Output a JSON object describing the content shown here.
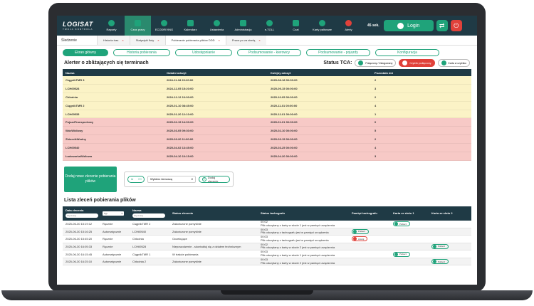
{
  "app": {
    "logo": "LOGISAT",
    "logo_sub": "TWOJA KONTROLA"
  },
  "nav": [
    {
      "label": "Raporty",
      "icon": "report-icon"
    },
    {
      "label": "Czas pracy",
      "icon": "clock-icon"
    },
    {
      "label": "ECODRIVING",
      "icon": "eco-drop-icon"
    },
    {
      "label": "Kalendarz",
      "icon": "calendar-icon"
    },
    {
      "label": "Ustawienia",
      "icon": "gear-icon"
    },
    {
      "label": "Administracja",
      "icon": "admin-icon"
    },
    {
      "label": "e-TOLL",
      "icon": "etoll-icon"
    },
    {
      "label": "Czat",
      "icon": "chat-icon"
    },
    {
      "label": "Karty paliwowe",
      "icon": "fuel-card-icon"
    },
    {
      "label": "Alerty",
      "icon": "alert-bell-icon"
    }
  ],
  "timer": "45 sek.",
  "login_label": "Login",
  "crumbs": {
    "home": "Śledzenie",
    "tabs": [
      "Historia tras",
      "Statystyki floty",
      "Pobieranie pobierania plików DDD",
      "Praca po za strefą"
    ]
  },
  "subtabs": [
    "Ekran główny",
    "Historia pobierania",
    "Udostępnianie",
    "Podsumowanie - kierowcy",
    "Podsumowanie - pojazdy",
    "Konfiguracja"
  ],
  "alerter": {
    "title": "Alerter o zbliżających się terminach",
    "tca_label": "Status TCA:",
    "tca_pills": [
      "Połączony / Zalogowany",
      "Czytnik podłączony",
      "Karta w czytniku"
    ]
  },
  "alerts_table": {
    "headers": [
      "Nazwa",
      "Ostatni odczyt",
      "Kolejny odczyt",
      "Pozostało dni"
    ],
    "rows": [
      {
        "name": "CiągnikTMR 3",
        "last": "2024-11-18 20:20:00",
        "next": "2025-08-18 00:00:00",
        "days": "2",
        "color": "yellow"
      },
      {
        "name": "LCH69528",
        "last": "2024-12-05 15:20:00",
        "next": "2025-09-15 00:00:00",
        "days": "3",
        "color": "yellow"
      },
      {
        "name": "Chłodnia",
        "last": "2024-12-12 10:00:00",
        "next": "2025-10-05 00:00:00",
        "days": "2",
        "color": "yellow"
      },
      {
        "name": "CiągnikTMR 2",
        "last": "2025-01-10 08:45:00",
        "next": "2025-11-01 00:00:00",
        "days": "4",
        "color": "yellow"
      },
      {
        "name": "LCH69535",
        "last": "2025-01-20 12:10:00",
        "next": "2025-12-01 00:00:00",
        "days": "1",
        "color": "yellow"
      },
      {
        "name": "PojazdTransportowy",
        "last": "2025-02-15 14:00:00",
        "next": "2025-01-01 00:00:00",
        "days": "0",
        "color": "red"
      },
      {
        "name": "WózWidlowy",
        "last": "2025-03-05 09:30:00",
        "next": "2025-02-10 00:00:00",
        "days": "5",
        "color": "red"
      },
      {
        "name": "ZbiornikWodny",
        "last": "2025-03-20 11:00:00",
        "next": "2025-03-15 00:00:00",
        "days": "2",
        "color": "red"
      },
      {
        "name": "LCH69540",
        "last": "2025-04-02 13:45:00",
        "next": "2025-03-25 00:00:00",
        "days": "4",
        "color": "red"
      },
      {
        "name": "ŁadowarkaWidlowa",
        "last": "2025-04-10 10:15:00",
        "next": "2025-04-20 00:00:00",
        "days": "3",
        "color": "red"
      }
    ]
  },
  "orders_panel": {
    "add_order": "Dodaj nowe zlecenie pobierania plików",
    "driver_select": "Wybierz kierowcę",
    "add_button": "Dodaj zlecenie"
  },
  "orders": {
    "title": "Lista zleceń pobierania plików",
    "headers": [
      "Data zlecenia",
      "Typ",
      "Nazwa",
      "Status zlecenia",
      "Status tachografu",
      "Pamięć tachografu",
      "Karta ze slotu 1",
      "Karta ze slotu 2"
    ],
    "filter_placeholder": "Wyszukaj",
    "type_filter": "Typ",
    "rows": [
      {
        "date": "2025-06-30 15:19:12",
        "type": "Ręcznie",
        "name": "CiągnikTMR 2",
        "status": "Zakończone pomyślnie",
        "tacho_time": "00:02",
        "tacho": "Plik odczytany z karty w slocie 1 jest w pamięci urządzenia",
        "mem": "",
        "slot1": "Pobierz",
        "slot2": ""
      },
      {
        "date": "2025-06-30 15:16:25",
        "type": "Automatycznie",
        "name": "LCH69540",
        "status": "Zakończone pomyślnie",
        "tacho_time": "00:03",
        "tacho": "Plik odczytany z tachografu jest w pamięci urządzenia",
        "mem": "Pobierz",
        "slot1": "",
        "slot2": ""
      },
      {
        "date": "2025-06-30 15:45:20",
        "type": "Ręcznie",
        "name": "Chłodnia",
        "status": "Oczekujące",
        "tacho_time": "00:03",
        "tacho": "Plik odczytany z tachografu jest w pamięci urządzenia",
        "mem": "Anuluj",
        "slot1": "",
        "slot2": ""
      },
      {
        "date": "2025-06-30 16:05:33",
        "type": "Ręcznie",
        "name": "LCH69528",
        "status": "Niepowodzenie - skontaktuj się z działem technicznym",
        "tacho_time": "00:02",
        "tacho": "Plik odczytany z karty w slocie 2 jest w pamięci urządzenia",
        "mem": "",
        "slot1": "",
        "slot2": "Pobierz"
      },
      {
        "date": "2025-06-30 16:15:45",
        "type": "Automatycznie",
        "name": "CiągnikTMR 1",
        "status": "W trakcie pobierania",
        "tacho_time": "00:03",
        "tacho": "Plik odczytany z karty w slocie 1 jest w pamięci urządzenia",
        "mem": "",
        "slot1": "Pobierz",
        "slot2": ""
      },
      {
        "date": "2025-06-30 16:25:10",
        "type": "Automatycznie",
        "name": "Chłodnia 2",
        "status": "Zakończone pomyślnie",
        "tacho_time": "00:03",
        "tacho": "Plik odczytany z karty w slocie 2 jest w pamięci urządzenia",
        "mem": "",
        "slot1": "",
        "slot2": "Pobierz"
      }
    ]
  }
}
